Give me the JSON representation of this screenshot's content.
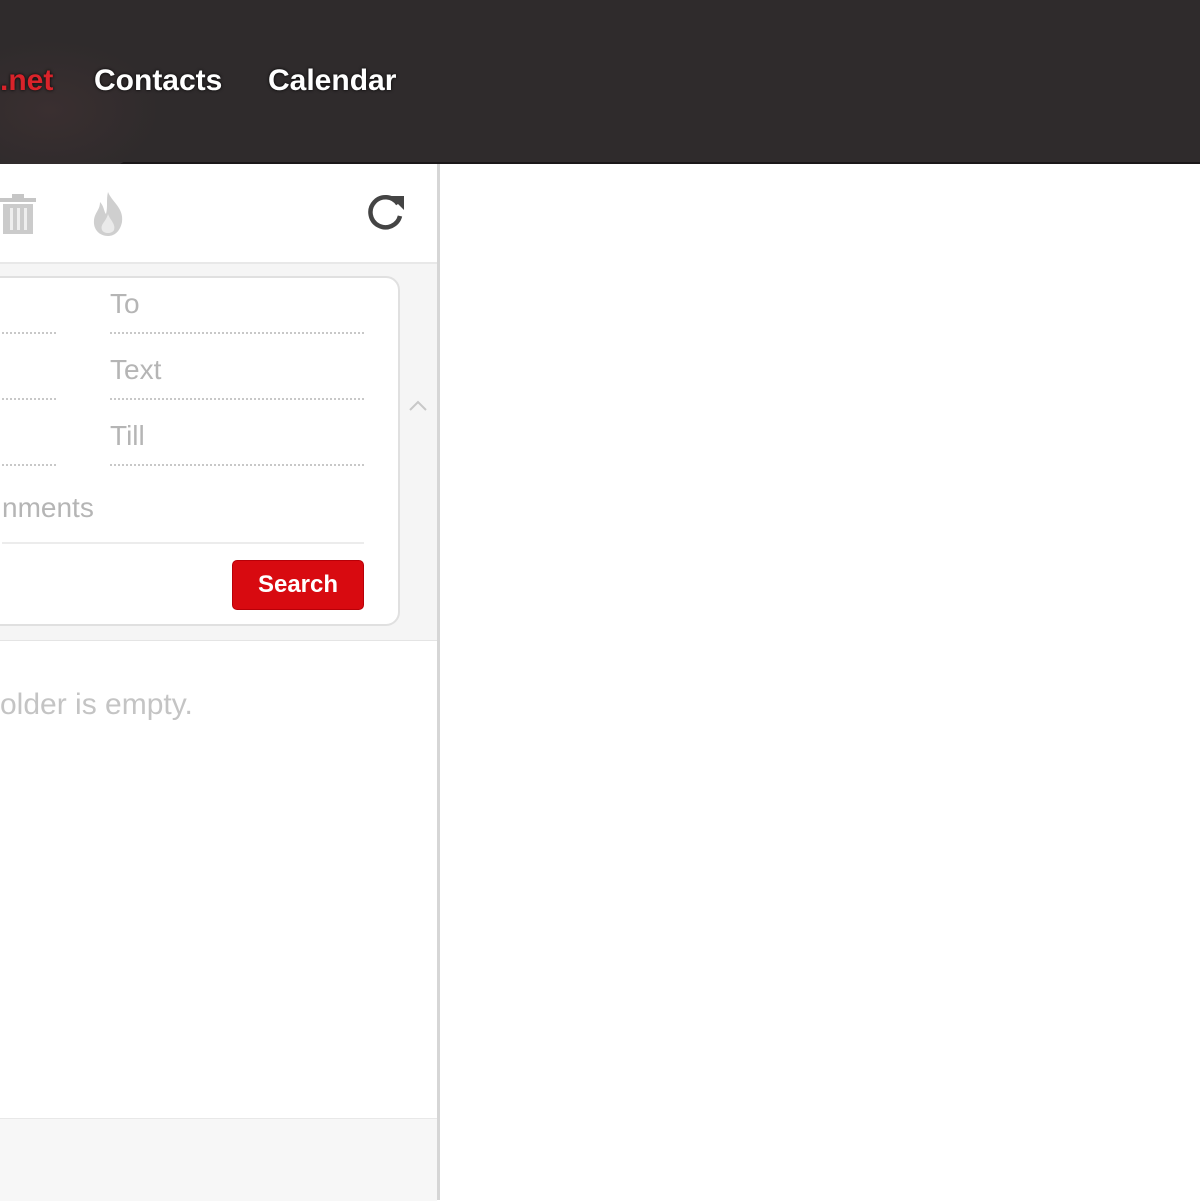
{
  "header": {
    "brand_fragment": ".net",
    "nav": [
      {
        "label": "Contacts"
      },
      {
        "label": "Calendar"
      }
    ],
    "brand_color": "#d9232a"
  },
  "toolbar": {
    "icons": [
      "trash-icon",
      "fire-icon",
      "refresh-icon"
    ]
  },
  "search": {
    "fields": [
      {
        "placeholder": "To"
      },
      {
        "placeholder": "Text"
      },
      {
        "placeholder": "Till"
      }
    ],
    "attachments_label_fragment": "nments",
    "search_button": "Search",
    "button_color": "#d80a10"
  },
  "message_list": {
    "empty_text": "older is empty."
  }
}
